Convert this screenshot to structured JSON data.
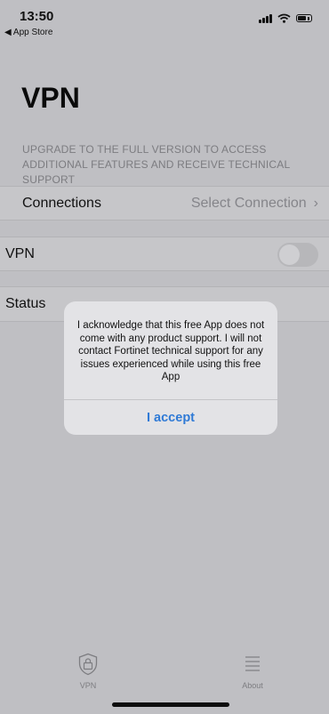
{
  "status_bar": {
    "time": "13:50",
    "back_app": "◀ App Store",
    "signal_icon": "signal-bars-icon",
    "wifi_icon": "wifi-icon",
    "battery_icon": "battery-icon"
  },
  "page": {
    "title": "VPN",
    "upgrade_note": "UPGRADE TO THE FULL VERSION TO ACCESS ADDITIONAL FEATURES AND RECEIVE TECHNICAL SUPPORT"
  },
  "settings": {
    "connections_label": "Connections",
    "connections_value": "Select Connection",
    "vpn_label": "VPN",
    "vpn_toggle_on": false,
    "status_label": "Status"
  },
  "alert": {
    "message": "I acknowledge that this free App does not come with any product support. I will not contact Fortinet technical support for any issues experienced while using this free App",
    "accept_label": "I accept",
    "accent_color": "#2f7ad6"
  },
  "tab_bar": {
    "tabs": [
      {
        "label": "VPN",
        "icon": "lock-shield-icon"
      },
      {
        "label": "About",
        "icon": "list-icon"
      }
    ]
  }
}
